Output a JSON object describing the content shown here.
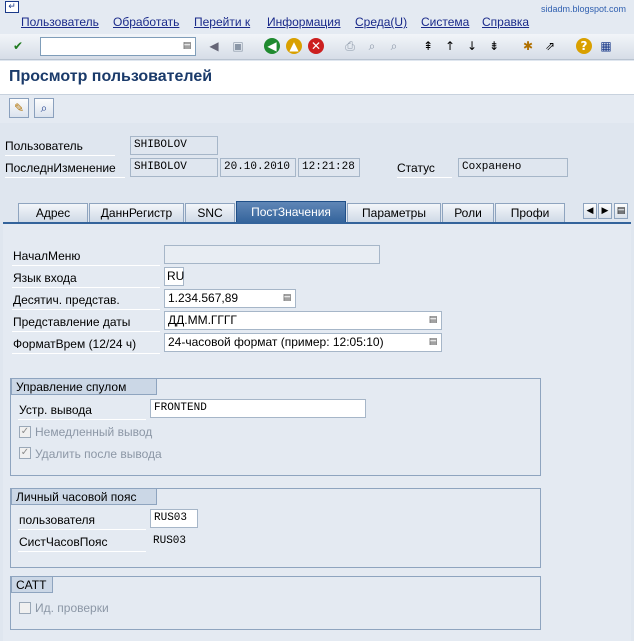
{
  "watermark": "sidadm.blogspot.com",
  "menu": [
    "Пользователь",
    "Обработать",
    "Перейти к",
    "Информация",
    "Среда(U)",
    "Система",
    "Справка"
  ],
  "icons": {
    "menu": "window-menu-icon",
    "toolbar": [
      "enter-icon",
      "back-icon",
      "exit-icon",
      "cancel-icon",
      "print-icon",
      "find-icon",
      "find-next-icon",
      "first-page-icon",
      "previous-page-icon",
      "next-page-icon",
      "last-page-icon",
      "new-session-icon",
      "shortcut-icon",
      "help-icon",
      "layout-menu-icon"
    ],
    "app": [
      "change-icon",
      "display-icon"
    ]
  },
  "title": "Просмотр пользователей",
  "header": {
    "user_label": "Пользователь",
    "user_value": "SHIBOLOV",
    "changed_label": "ПоследнИзменение",
    "changed_by": "SHIBOLOV",
    "changed_date": "20.10.2010",
    "changed_time": "12:21:28",
    "status_label": "Статус",
    "status_value": "Сохранено"
  },
  "tabs": [
    "Адрес",
    "ДаннРегистр",
    "SNC",
    "ПостЗначения",
    "Параметры",
    "Роли",
    "Профи"
  ],
  "active_tab": "ПостЗначения",
  "defaults": {
    "start_menu_label": "НачалМеню",
    "start_menu_value": "",
    "logon_lang_label": "Язык входа",
    "logon_lang_value": "RU",
    "decimal_label": "Десятич. представ.",
    "decimal_value": "1.234.567,89",
    "date_format_label": "Представление даты",
    "date_format_value": "ДД.ММ.ГГГГ",
    "time_format_label": "ФорматВрем (12/24 ч)",
    "time_format_value": "24-часовой формат (пример: 12:05:10)"
  },
  "spool": {
    "title": "Управление спулом",
    "device_label": "Устр. вывода",
    "device_value": "FRONTEND",
    "print_immediately_label": "Немедленный вывод",
    "print_immediately_checked": true,
    "delete_after_label": "Удалить после вывода",
    "delete_after_checked": true
  },
  "timezone": {
    "title": "Личный часовой пояс",
    "user_label": "пользователя",
    "user_value": "RUS03",
    "system_label": "СистЧасовПояс",
    "system_value": "RUS03"
  },
  "catt": {
    "title": "CATT",
    "check_label": "Ид. проверки",
    "check_checked": false
  }
}
